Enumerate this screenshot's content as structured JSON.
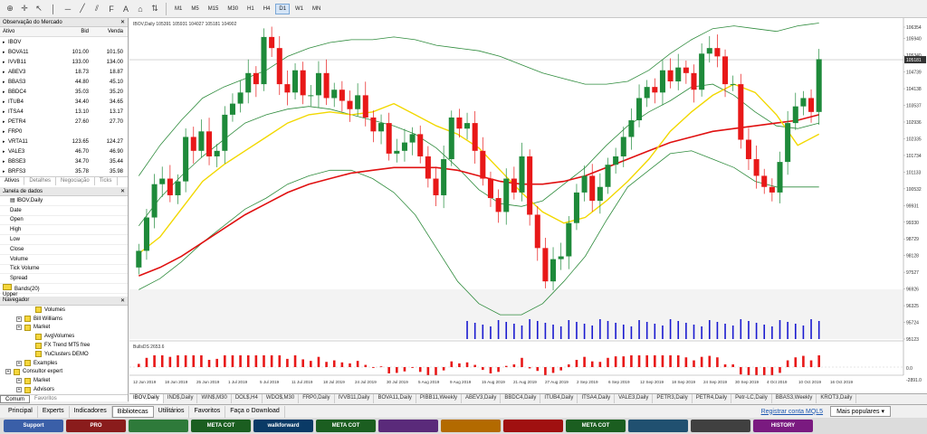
{
  "toolbar": {
    "timeframes": [
      "M1",
      "M5",
      "M15",
      "M30",
      "H1",
      "H4",
      "D1",
      "W1",
      "MN"
    ],
    "active_timeframe": "D1",
    "icons": [
      "new-order-icon",
      "crosshair-icon",
      "cursor-icon",
      "vertical-line-icon",
      "horizontal-line-icon",
      "trendline-icon",
      "channel-icon",
      "fibonacci-icon",
      "text-icon",
      "label-icon",
      "arrows-icon"
    ]
  },
  "market_watch": {
    "title": "Observação do Mercado",
    "headers": [
      "Ativo",
      "Bid",
      "Venda"
    ],
    "rows": [
      {
        "symbol": "IBOV",
        "bid": "",
        "ask": ""
      },
      {
        "symbol": "BOVA11",
        "bid": "101.00",
        "ask": "101.50"
      },
      {
        "symbol": "IVVB11",
        "bid": "133.00",
        "ask": "134.00"
      },
      {
        "symbol": "ABEV3",
        "bid": "18.73",
        "ask": "18.87"
      },
      {
        "symbol": "BBAS3",
        "bid": "44.80",
        "ask": "45.10"
      },
      {
        "symbol": "BBDC4",
        "bid": "35.03",
        "ask": "35.20"
      },
      {
        "symbol": "ITUB4",
        "bid": "34.40",
        "ask": "34.65"
      },
      {
        "symbol": "ITSA4",
        "bid": "13.10",
        "ask": "13.17"
      },
      {
        "symbol": "PETR4",
        "bid": "27.60",
        "ask": "27.70"
      },
      {
        "symbol": "FRP0",
        "bid": "",
        "ask": ""
      },
      {
        "symbol": "VRTA11",
        "bid": "123.65",
        "ask": "124.27"
      },
      {
        "symbol": "VALE3",
        "bid": "46.70",
        "ask": "46.90"
      },
      {
        "symbol": "BBSE3",
        "bid": "34.70",
        "ask": "35.44"
      },
      {
        "symbol": "BRFS3",
        "bid": "35.78",
        "ask": "35.98"
      }
    ],
    "tabs": [
      "Ativos",
      "Detalhes",
      "Negociação",
      "Ticks"
    ],
    "active_tab": "Ativos"
  },
  "data_window": {
    "title": "Janela de dados",
    "symbol": "IBOV,Daily",
    "fields": [
      "Date",
      "Open",
      "High",
      "Low",
      "Close",
      "Volume",
      "Tick Volume",
      "Spread"
    ],
    "indicator": "Bands(20) Upper"
  },
  "navigator": {
    "title": "Navegador",
    "items": [
      {
        "label": "Volumes",
        "indent": 2,
        "type": "check"
      },
      {
        "label": "Bill Williams",
        "indent": 1,
        "type": "folder"
      },
      {
        "label": "Market",
        "indent": 1,
        "type": "folder"
      },
      {
        "label": "AvgVolumes",
        "indent": 2,
        "type": "check"
      },
      {
        "label": "FX Trend MT5 free",
        "indent": 2,
        "type": "check"
      },
      {
        "label": "YuClusters DEMO",
        "indent": 2,
        "type": "check"
      },
      {
        "label": "Examples",
        "indent": 1,
        "type": "folder"
      },
      {
        "label": "Consultor expert",
        "indent": 0,
        "type": "folder"
      },
      {
        "label": "Market",
        "indent": 1,
        "type": "folder"
      },
      {
        "label": "Advisors",
        "indent": 1,
        "type": "folder"
      }
    ],
    "tabs": [
      "Comum",
      "Favoritos"
    ],
    "active_tab": "Comum"
  },
  "chart_data": {
    "type": "candlestick",
    "symbol_header": "IBOV,Daily 105391 105931 104027 105181 104902",
    "price_labels": [
      "106354",
      "105940",
      "105340",
      "104739",
      "104138",
      "103537",
      "102936",
      "102335",
      "101734",
      "101133",
      "100532",
      "99931",
      "99330",
      "98729",
      "98128",
      "97527",
      "96926",
      "96325",
      "95724",
      "95123"
    ],
    "current_price": "105181",
    "date_labels": [
      "12 Jun 2019",
      "18 Jun 2019",
      "25 Jun 2019",
      "1 Jul 2019",
      "5 Jul 2019",
      "11 Jul 2019",
      "18 Jul 2019",
      "24 Jul 2019",
      "30 Jul 2019",
      "5 Aug 2019",
      "9 Aug 2019",
      "15 Aug 2019",
      "21 Aug 2019",
      "27 Aug 2019",
      "2 Sep 2019",
      "6 Sep 2019",
      "12 Sep 2019",
      "18 Sep 2019",
      "24 Sep 2019",
      "30 Sep 2019",
      "4 Oct 2019",
      "10 Oct 2019",
      "16 Oct 2019"
    ],
    "closes": [
      98300,
      99500,
      100700,
      100900,
      100300,
      100800,
      102400,
      101900,
      102600,
      101700,
      101900,
      103200,
      103600,
      104000,
      104700,
      104300,
      106000,
      105600,
      104300,
      104000,
      104800,
      103900,
      103900,
      104700,
      103800,
      104100,
      103700,
      103400,
      103900,
      103100,
      102600,
      102900,
      101800,
      101900,
      102200,
      102500,
      101700,
      100900,
      100300,
      101600,
      103100,
      102700,
      102900,
      101900,
      100900,
      100200,
      99700,
      100900,
      100400,
      101700,
      99600,
      98400,
      97200,
      98000,
      98100,
      99300,
      100400,
      101000,
      100100,
      100600,
      101400,
      101700,
      102400,
      103000,
      103800,
      104200,
      104000,
      104800,
      104400,
      104900,
      104700,
      104100,
      105400,
      105600,
      105300,
      104300,
      104300,
      102300,
      101600,
      101000,
      100600,
      100400,
      101500,
      102900,
      103500,
      103800,
      103300,
      105200
    ],
    "upper_band": [
      101000,
      102100,
      103000,
      103800,
      104200,
      104500,
      104800,
      105300,
      105600,
      105800,
      105900,
      105900,
      106000,
      105900,
      105700,
      105600,
      105500,
      105300,
      105000,
      104700,
      104500,
      104300,
      104300,
      104400,
      104800,
      105400,
      105900,
      106300,
      106400,
      106300,
      106200,
      106400,
      106500
    ],
    "middle_band": [
      99200,
      100200,
      101000,
      101700,
      102300,
      102900,
      103200,
      103400,
      103500,
      103400,
      103200,
      103000,
      102800,
      102500,
      102000,
      101300,
      100500,
      100000,
      99900,
      100100,
      100700,
      101300,
      102100,
      102800,
      103300,
      103700,
      104200,
      104300,
      103900,
      103300,
      102800,
      102700,
      102900
    ],
    "lower_band": [
      96900,
      97300,
      97900,
      98600,
      99200,
      99800,
      100200,
      100700,
      101000,
      101200,
      101200,
      100900,
      100400,
      99600,
      98400,
      97200,
      96400,
      96000,
      96000,
      96400,
      97200,
      98100,
      99400,
      100600,
      101200,
      101800,
      101900,
      101600,
      101300,
      100800,
      100600,
      100600,
      100600
    ],
    "ma_slow_red": [
      97400,
      97700,
      98100,
      98600,
      99100,
      99600,
      100000,
      100400,
      100700,
      100900,
      101100,
      101200,
      101300,
      101300,
      101300,
      101200,
      101000,
      100800,
      100700,
      100700,
      100800,
      101000,
      101300,
      101600,
      101900,
      102200,
      102400,
      102600,
      102700,
      102800,
      102900,
      103000,
      103200
    ],
    "ma_fast_yellow": [
      98200,
      98800,
      99800,
      100800,
      101400,
      101900,
      102400,
      102900,
      103200,
      103300,
      103200,
      103300,
      103600,
      103200,
      102800,
      102500,
      102000,
      101200,
      100400,
      99700,
      99300,
      99500,
      100100,
      100800,
      101600,
      102600,
      103300,
      103900,
      104300,
      104000,
      103200,
      102100,
      102500
    ],
    "bulls_power": {
      "label": "BullsDS 2653.6",
      "axis": [
        "0.0",
        "-2891.0"
      ]
    }
  },
  "chart_tabs": [
    "IBOV,Daily",
    "IND$,Daily",
    "WIN$,M30",
    "DOL$,H4",
    "WDO$,M30",
    "FRP0,Daily",
    "IVVB11,Daily",
    "BOVA11,Daily",
    "PIBB11,Weekly",
    "ABEV3,Daily",
    "BBDC4,Daily",
    "ITUB4,Daily",
    "ITSA4,Daily",
    "VALE3,Daily",
    "PETR3,Daily",
    "PETR4,Daily",
    "Petr-LC,Daily",
    "BBAS3,Weekly",
    "KROT3,Daily"
  ],
  "active_chart_tab": "IBOV,Daily",
  "bottom_tabs": [
    "Principal",
    "Experts",
    "Indicadores",
    "Bibliotecas",
    "Utilitários",
    "Favoritos",
    "Faça o Download"
  ],
  "active_bottom_tab": "Bibliotecas",
  "register_link": "Registrar conta MQL5",
  "popular_select": "Mais populares",
  "market_thumbs": [
    {
      "text": "Support",
      "color": "#3a5fa8"
    },
    {
      "text": "PRO",
      "color": "#8a1c1c"
    },
    {
      "text": "",
      "color": "#2e7a3a"
    },
    {
      "text": "META COT",
      "color": "#1b5e20"
    },
    {
      "text": "walkforward",
      "color": "#0a3a66"
    },
    {
      "text": "META COT",
      "color": "#1b5e20"
    },
    {
      "text": "",
      "color": "#5a2a7a"
    },
    {
      "text": "",
      "color": "#b36a00"
    },
    {
      "text": "",
      "color": "#a01010"
    },
    {
      "text": "META COT",
      "color": "#1b5e20"
    },
    {
      "text": "",
      "color": "#205070"
    },
    {
      "text": "",
      "color": "#404040"
    },
    {
      "text": "HISTORY",
      "color": "#7a1a80"
    }
  ]
}
